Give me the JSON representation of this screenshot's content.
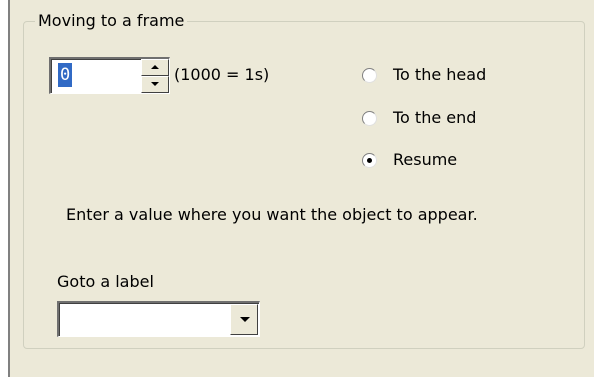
{
  "group": {
    "title": "Moving to a frame"
  },
  "frame_spinner": {
    "value": "0",
    "caption": "(1000 = 1s)"
  },
  "position_options": [
    {
      "label": "To the head",
      "selected": false
    },
    {
      "label": "To the end",
      "selected": false
    },
    {
      "label": "Resume",
      "selected": true
    }
  ],
  "info_text": "Enter a value where you want the object to appear.",
  "goto": {
    "label": "Goto a label",
    "selected_value": ""
  },
  "colors": {
    "panel_background": "#ece9d8",
    "selection_highlight": "#316ac5"
  },
  "icons": {
    "spin_up": "up-arrow-icon",
    "spin_down": "down-arrow-icon",
    "dropdown": "chevron-down-icon"
  }
}
